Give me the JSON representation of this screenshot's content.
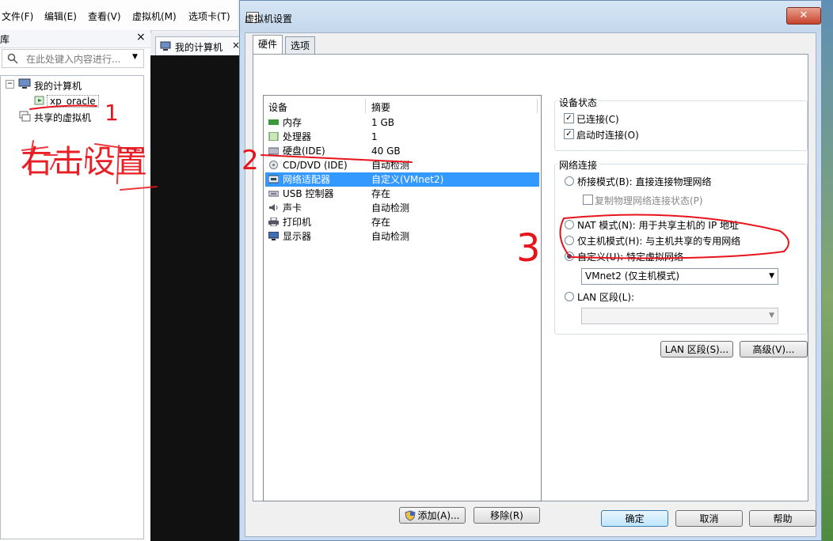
{
  "menubar": {
    "items": [
      "文件(F)",
      "编辑(E)",
      "查看(V)",
      "虚拟机(M)",
      "选项卡(T)"
    ]
  },
  "library": {
    "title": "库",
    "close": "×",
    "search_placeholder": "在此处键入内容进行...",
    "tree": {
      "root": "我的计算机",
      "vm": "xp_oracle",
      "shared": "共享的虚拟机"
    }
  },
  "vmtab": {
    "label": "我的计算机",
    "close": "×"
  },
  "dialog": {
    "title": "虚拟机设置",
    "close": "✕",
    "tabs": [
      "硬件",
      "选项"
    ],
    "device_list": {
      "headers": [
        "设备",
        "摘要"
      ],
      "rows": [
        {
          "device": "内存",
          "summary": "1 GB",
          "selected": false
        },
        {
          "device": "处理器",
          "summary": "1",
          "selected": false
        },
        {
          "device": "硬盘(IDE)",
          "summary": "40 GB",
          "selected": false
        },
        {
          "device": "CD/DVD (IDE)",
          "summary": "自动检测",
          "selected": false
        },
        {
          "device": "网络适配器",
          "summary": "自定义(VMnet2)",
          "selected": true
        },
        {
          "device": "USB 控制器",
          "summary": "存在",
          "selected": false
        },
        {
          "device": "声卡",
          "summary": "自动检测",
          "selected": false
        },
        {
          "device": "打印机",
          "summary": "存在",
          "selected": false
        },
        {
          "device": "显示器",
          "summary": "自动检测",
          "selected": false
        }
      ]
    },
    "add_button": "添加(A)...",
    "remove_button": "移除(R)",
    "device_status": {
      "title": "设备状态",
      "connected": "已连接(C)",
      "connected_checked": true,
      "connect_on_power": "启动时连接(O)",
      "connect_on_power_checked": true
    },
    "network": {
      "title": "网络连接",
      "bridged": "桥接模式(B): 直接连接物理网络",
      "replicate": "复制物理网络连接状态(P)",
      "nat": "NAT 模式(N): 用于共享主机的 IP 地址",
      "hostonly": "仅主机模式(H): 与主机共享的专用网络",
      "custom": "自定义(U): 特定虚拟网络",
      "custom_value": "VMnet2 (仅主机模式)",
      "lan": "LAN 区段(L):",
      "selected": "custom"
    },
    "lan_segments_button": "LAN 区段(S)...",
    "advanced_button": "高级(V)...",
    "ok_button": "确定",
    "cancel_button": "取消",
    "help_button": "帮助"
  },
  "annotations": {
    "step1": "1",
    "step2": "2",
    "step3": "3",
    "handwriting": "右击设置"
  },
  "colors": {
    "selection": "#3399ff",
    "annotation": "#e8141b",
    "dialog_frame": "#c9dcef"
  }
}
